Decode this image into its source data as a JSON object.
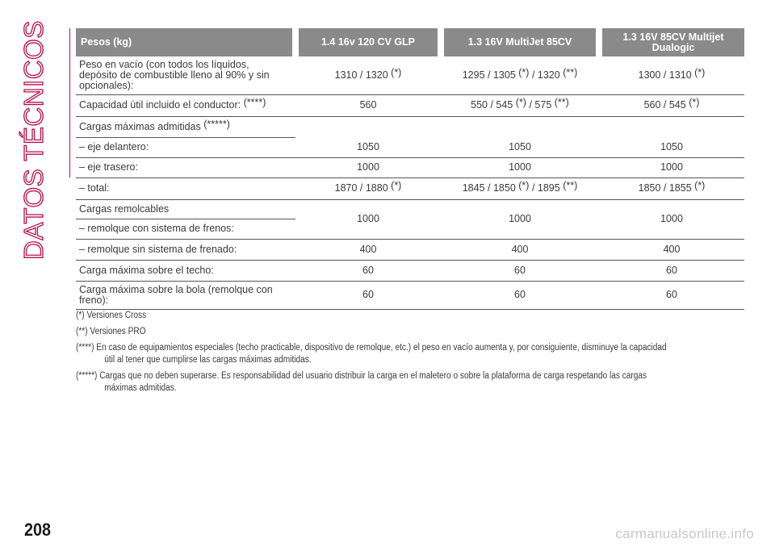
{
  "section": "DATOS TÉCNICOS",
  "page_number": "208",
  "watermark": "carmanualsonline.info",
  "table": {
    "headers": [
      "Pesos (kg)",
      "1.4 16v 120 CV GLP",
      "1.3 16V MultiJet 85CV",
      "1.3 16V 85CV Multijet Dualogic"
    ],
    "rows": {
      "peso_vacio": {
        "label": "Peso en vacío (con todos los líquidos, depósito de combustible lleno al 90% y sin opcionales):",
        "c1": "1310 / 1320",
        "c1s": "(*)",
        "c2a": "1295 / 1305",
        "c2as": "(*)",
        "c2b": "/ 1320",
        "c2bs": "(**)",
        "c3": "1300 / 1310",
        "c3s": "(*)"
      },
      "capacidad": {
        "label": "Capacidad útil incluido el conductor:",
        "labels": "(****)",
        "c1": "560",
        "c2a": "550 / 545",
        "c2as": "(*)",
        "c2b": "/ 575",
        "c2bs": "(**)",
        "c3": "560 / 545",
        "c3s": "(*)"
      },
      "cargas_max": {
        "label": "Cargas máximas admitidas",
        "labels": "(*****)"
      },
      "eje_del": {
        "label": "– eje delantero:",
        "c1": "1050",
        "c2": "1050",
        "c3": "1050"
      },
      "eje_tras": {
        "label": "– eje trasero:",
        "c1": "1000",
        "c2": "1000",
        "c3": "1000"
      },
      "total": {
        "label": "– total:",
        "c1": "1870 / 1880",
        "c1s": "(*)",
        "c2a": "1845 / 1850",
        "c2as": "(*)",
        "c2b": "/ 1895",
        "c2bs": "(**)",
        "c3": "1850 / 1855",
        "c3s": "(*)"
      },
      "remolcables": {
        "label": "Cargas remolcables",
        "c1": "1000",
        "c2": "1000",
        "c3": "1000"
      },
      "remolque_frenos": {
        "label": "– remolque con sistema de frenos:"
      },
      "remolque_sin": {
        "label": "– remolque sin sistema de frenado:",
        "c1": "400",
        "c2": "400",
        "c3": "400"
      },
      "techo": {
        "label": "Carga máxima sobre el techo:",
        "c1": "60",
        "c2": "60",
        "c3": "60"
      },
      "bola": {
        "label": "Carga máxima sobre la bola (remolque con freno):",
        "c1": "60",
        "c2": "60",
        "c3": "60"
      }
    }
  },
  "notes": {
    "n1": "(*) Versiones Cross",
    "n2": "(**) Versiones PRO",
    "n4a": "(****) En caso de equipamientos especiales (techo practicable, dispositivo de remolque, etc.) el peso en vacío aumenta y, por consiguiente, disminuye la capacidad",
    "n4b": "útil al tener que cumplirse las cargas máximas admitidas.",
    "n5a": "(*****) Cargas que no deben superarse. Es responsabilidad del usuario distribuir la carga en el maletero o sobre la plataforma de carga respetando las cargas",
    "n5b": "máximas admitidas."
  }
}
